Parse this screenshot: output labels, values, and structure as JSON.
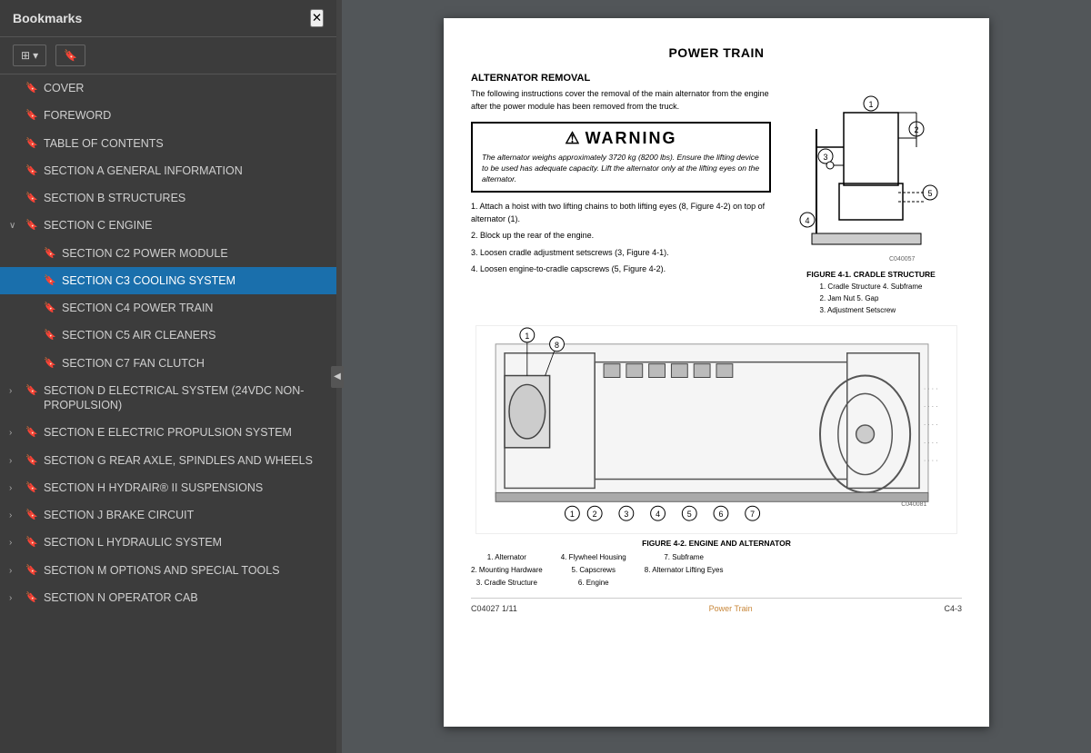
{
  "sidebar": {
    "title": "Bookmarks",
    "close_label": "✕",
    "toolbar": {
      "view_btn": "☰▾",
      "bookmark_btn": "🔖"
    },
    "items": [
      {
        "id": "cover",
        "label": "COVER",
        "indent": 0,
        "expanded": false,
        "active": false
      },
      {
        "id": "foreword",
        "label": "FOREWORD",
        "indent": 0,
        "expanded": false,
        "active": false
      },
      {
        "id": "toc",
        "label": "TABLE OF CONTENTS",
        "indent": 0,
        "expanded": false,
        "active": false
      },
      {
        "id": "sec-a",
        "label": "SECTION A GENERAL INFORMATION",
        "indent": 0,
        "expanded": false,
        "active": false
      },
      {
        "id": "sec-b",
        "label": "SECTION B STRUCTURES",
        "indent": 0,
        "expanded": false,
        "active": false
      },
      {
        "id": "sec-c",
        "label": "SECTION C ENGINE",
        "indent": 0,
        "expanded": true,
        "active": false
      },
      {
        "id": "sec-c2",
        "label": "SECTION C2 POWER MODULE",
        "indent": 1,
        "expanded": false,
        "active": false
      },
      {
        "id": "sec-c3",
        "label": "SECTION C3 COOLING SYSTEM",
        "indent": 1,
        "expanded": false,
        "active": true
      },
      {
        "id": "sec-c4",
        "label": "SECTION C4 POWER TRAIN",
        "indent": 1,
        "expanded": false,
        "active": false
      },
      {
        "id": "sec-c5",
        "label": "SECTION C5 AIR CLEANERS",
        "indent": 1,
        "expanded": false,
        "active": false
      },
      {
        "id": "sec-c7",
        "label": "SECTION C7 FAN CLUTCH",
        "indent": 1,
        "expanded": false,
        "active": false
      },
      {
        "id": "sec-d",
        "label": "SECTION D ELECTRICAL SYSTEM (24VDC NON-PROPULSION)",
        "indent": 0,
        "expanded": false,
        "active": false
      },
      {
        "id": "sec-e",
        "label": "SECTION E ELECTRIC PROPULSION SYSTEM",
        "indent": 0,
        "expanded": false,
        "active": false
      },
      {
        "id": "sec-g",
        "label": "SECTION G REAR AXLE, SPINDLES AND WHEELS",
        "indent": 0,
        "expanded": false,
        "active": false
      },
      {
        "id": "sec-h",
        "label": "SECTION H HYDRAIR® II SUSPENSIONS",
        "indent": 0,
        "expanded": false,
        "active": false
      },
      {
        "id": "sec-j",
        "label": "SECTION J BRAKE CIRCUIT",
        "indent": 0,
        "expanded": false,
        "active": false
      },
      {
        "id": "sec-l",
        "label": "SECTION L HYDRAULIC SYSTEM",
        "indent": 0,
        "expanded": false,
        "active": false
      },
      {
        "id": "sec-m",
        "label": "SECTION M OPTIONS AND SPECIAL TOOLS",
        "indent": 0,
        "expanded": false,
        "active": false
      },
      {
        "id": "sec-n",
        "label": "SECTION N OPERATOR CAB",
        "indent": 0,
        "expanded": false,
        "active": false
      }
    ]
  },
  "pdf": {
    "page_title": "POWER TRAIN",
    "section_title": "ALTERNATOR REMOVAL",
    "intro_text": "The following instructions cover the removal of the main alternator from the engine after the power module has been removed from the truck.",
    "warning_title": "WARNING",
    "warning_body": "The alternator weighs approximately 3720 kg (8200 lbs). Ensure the lifting device to be used has adequate capacity. Lift the alternator only at the lifting eyes on the alternator.",
    "steps": [
      "1. Attach a hoist with two lifting chains to both lifting eyes (8, Figure 4-2) on top of alternator (1).",
      "2. Block up the rear of the engine.",
      "3. Loosen cradle adjustment setscrews (3, Figure 4-1).",
      "4. Loosen engine-to-cradle capscrews (5, Figure 4-2)."
    ],
    "figure1": {
      "caption": "FIGURE 4-1. CRADLE STRUCTURE",
      "legend": [
        "1. Cradle Structure    4. Subframe",
        "2. Jam Nut              5. Gap",
        "3. Adjustment Setscrew"
      ],
      "code": "C040057"
    },
    "figure2": {
      "caption": "FIGURE 4-2. ENGINE AND ALTERNATOR",
      "legend_col1": [
        "1. Alternator",
        "2. Mounting Hardware",
        "3. Cradle Structure"
      ],
      "legend_col2": [
        "4. Flywheel Housing",
        "5. Capscrews",
        "6. Engine"
      ],
      "legend_col3": [
        "7. Subframe",
        "8. Alternator Lifting Eyes"
      ],
      "code": "C040081"
    },
    "footer": {
      "left": "C04027  1/11",
      "center": "Power Train",
      "right": "C4-3"
    }
  }
}
